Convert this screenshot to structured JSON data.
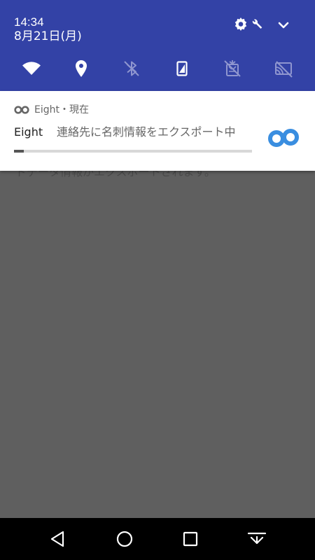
{
  "status": {
    "time": "14:34",
    "date": "8月21日(月)"
  },
  "quick_settings": [
    {
      "icon": "wifi-icon",
      "active": true
    },
    {
      "icon": "location-icon",
      "active": true
    },
    {
      "icon": "bluetooth-icon",
      "active": false
    },
    {
      "icon": "rotation-icon",
      "active": true
    },
    {
      "icon": "data-saver-icon",
      "active": false
    },
    {
      "icon": "cast-icon",
      "active": false
    }
  ],
  "notification": {
    "app_name": "Eight",
    "separator": "・",
    "when": "現在",
    "title": "Eight",
    "text": "連絡先に名刺情報をエクスポート中",
    "progress": 0.04
  },
  "background": {
    "partial_text": "ドデータ情報がエクスポートされます。"
  },
  "colors": {
    "shade_bg": "#3342a6",
    "app_accent": "#3a8ee0",
    "screen_bg": "#5f5f5f"
  }
}
